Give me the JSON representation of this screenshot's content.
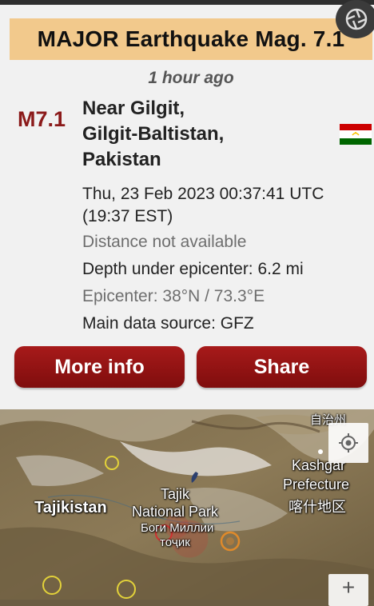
{
  "alert": {
    "title": "MAJOR Earthquake Mag. 7.1",
    "time_ago": "1 hour ago",
    "magnitude": "M7.1",
    "location_line1": "Near Gilgit,",
    "location_line2": "Gilgit-Baltistan,",
    "location_line3": "Pakistan",
    "datetime": "Thu, 23 Feb 2023 00:37:41 UTC",
    "datetime_local": "(19:37 EST)",
    "distance": "Distance not available",
    "depth": "Depth under epicenter: 6.2 mi",
    "epicenter": "Epicenter: 38°N / 73.3°E",
    "source": "Main data source: GFZ"
  },
  "buttons": {
    "more_info": "More info",
    "share": "Share"
  },
  "map": {
    "labels": {
      "tajikistan": "Tajikistan",
      "park_line1": "Tajik",
      "park_line2": "National Park",
      "park_line3": "Боги Миллии",
      "park_line4": "тоҷик",
      "kashgar_line1": "Kashgar",
      "kashgar_line2": "Prefecture",
      "kashgar_line3": "喀什地区",
      "top_right": "自治州"
    },
    "zoom_in": "+"
  },
  "icons": {
    "camera": "camera-shutter-icon",
    "flag": "tajikistan-flag-icon",
    "locate": "locate-icon"
  },
  "colors": {
    "banner": "#f2c98c",
    "magnitude": "#8b1a1a",
    "button": "#a71a1a"
  }
}
